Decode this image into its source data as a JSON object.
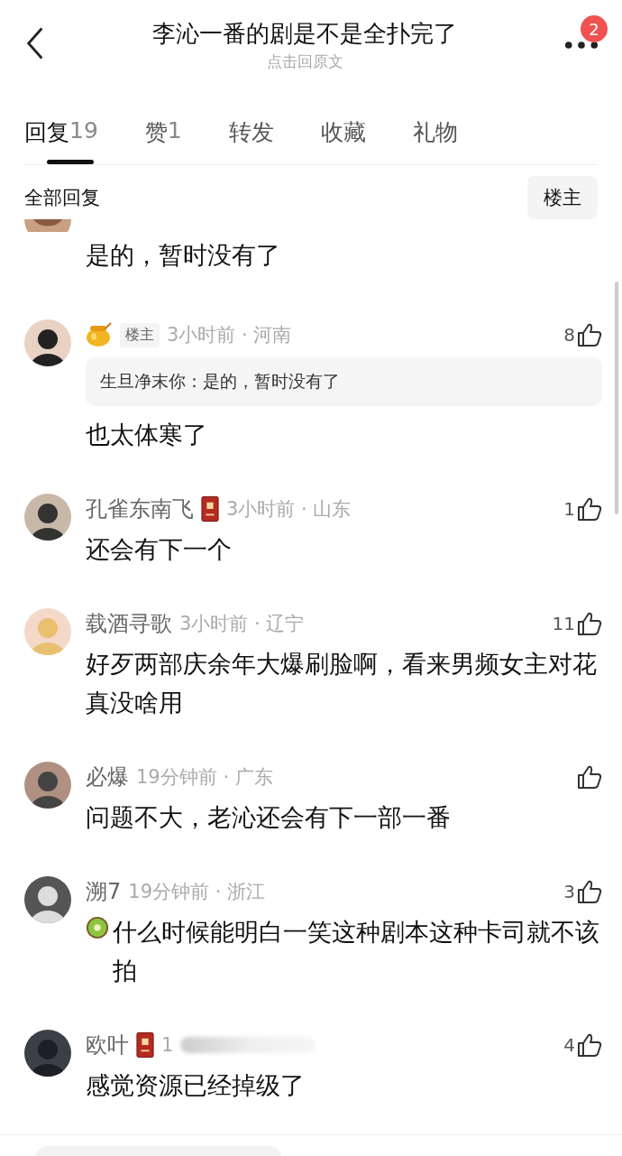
{
  "header": {
    "title": "李沁一番的剧是不是全扑完了",
    "subtitle": "点击回原文",
    "badge": "2"
  },
  "tabs": [
    {
      "label": "回复",
      "count": "19",
      "selected": true
    },
    {
      "label": "赞",
      "count": "1",
      "selected": false
    },
    {
      "label": "转发",
      "selected": false
    },
    {
      "label": "收藏",
      "selected": false
    },
    {
      "label": "礼物",
      "selected": false
    }
  ],
  "sort": {
    "label": "全部回复",
    "filter": "楼主"
  },
  "comments": [
    {
      "kind": "partial",
      "text": "是的，暂时没有了"
    },
    {
      "kind": "full",
      "badge": {
        "kind": "honey"
      },
      "op_tag": "楼主",
      "meta": "3小时前 · 河南",
      "likes": "8",
      "quote": "生旦净末你：是的，暂时没有了",
      "text": "也太体寒了"
    },
    {
      "kind": "full",
      "name": "孔雀东南飞",
      "badge": {
        "kind": "book"
      },
      "meta": "3小时前 · 山东",
      "likes": "1",
      "text": "还会有下一个"
    },
    {
      "kind": "full",
      "name": "载酒寻歌",
      "meta": "3小时前 · 辽宁",
      "likes": "11",
      "text": "好歹两部庆余年大爆刷脸啊，看来男频女主对花真没啥用"
    },
    {
      "kind": "full",
      "name": "必爆",
      "meta": "19分钟前 · 广东",
      "text": "问题不大，老沁还会有下一部一番"
    },
    {
      "kind": "full",
      "name": "溯7",
      "meta": "19分钟前 · 浙江",
      "likes": "3",
      "text_icon": {
        "kind": "kiwi"
      },
      "text": "什么时候能明白一笑这种剧本这种卡司就不该拍"
    },
    {
      "kind": "full",
      "name": "欧叶",
      "badge": {
        "kind": "book"
      },
      "meta": "1",
      "blurred": true,
      "likes": "4",
      "text": "感觉资源已经掉级了"
    }
  ]
}
